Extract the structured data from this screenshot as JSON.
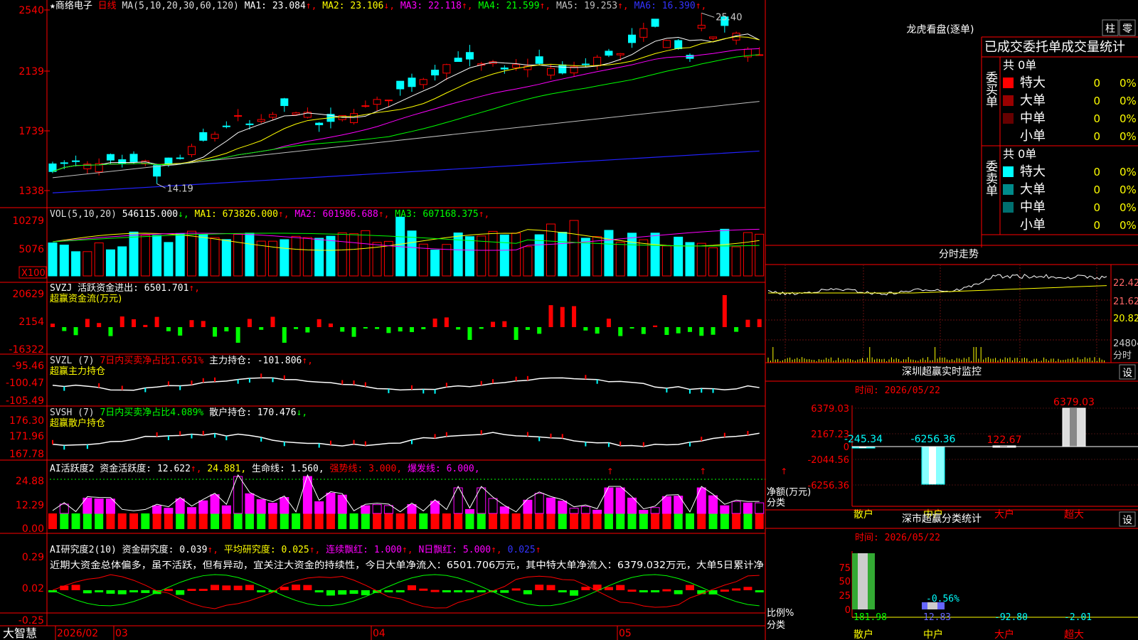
{
  "stock": {
    "name": "商络电子",
    "period": "日线",
    "star": "★"
  },
  "price": {
    "axis_labels": [
      "2540",
      "2139",
      "1739",
      "1338"
    ],
    "ma_header": "MA(5,10,20,30,60,120)",
    "ma_values": [
      {
        "label": "MA1: 23.084",
        "arrow": "↑",
        "color": "#ffffff"
      },
      {
        "label": "MA2: 23.106",
        "arrow": "↓",
        "color": "#ffff00"
      },
      {
        "label": "MA3: 22.118",
        "arrow": "↑",
        "color": "#ff00ff"
      },
      {
        "label": "MA4: 21.599",
        "arrow": "↑",
        "color": "#00ff00"
      },
      {
        "label": "MA5: 19.253",
        "arrow": "↑",
        "color": "#c0c0c0"
      },
      {
        "label": "MA6: 16.390",
        "arrow": "↑",
        "color": "#3333ff"
      }
    ],
    "high_label": "25.40",
    "low_label": "14.19"
  },
  "vol": {
    "header": "VOL(5,10,20)",
    "value": "546115.000",
    "value_arrow": "↓",
    "mas": [
      {
        "label": "MA1: 673826.000",
        "arrow": "↑",
        "color": "#ffff00"
      },
      {
        "label": "MA2: 601986.688",
        "arrow": "↑",
        "color": "#ff00ff"
      },
      {
        "label": "MA3: 607168.375",
        "arrow": "↑",
        "color": "#00ff00"
      }
    ],
    "axis_labels": [
      "10279",
      "5076"
    ],
    "unit": "X100"
  },
  "svzj": {
    "header": "SVZJ  活跃资金进出: 6501.701",
    "arrow": "↑",
    "subtitle": "超赢资金流(万元)",
    "axis_labels": [
      "20629",
      "2154",
      "-16322"
    ]
  },
  "svzl": {
    "header_pre": "SVZL (7)",
    "header_red": "7日内买卖净占比1.651%",
    "header_post": "主力持仓: -101.806",
    "arrow": "↑,",
    "subtitle": "超赢主力持仓",
    "axis_labels": [
      "-95.46",
      "-100.47",
      "-105.49"
    ]
  },
  "svsh": {
    "header_pre": "SVSH (7)",
    "header_green": "7日内买卖净占比4.089%",
    "header_post": "散户持仓: 170.476",
    "arrow": "↓,",
    "subtitle": "超赢散户持仓",
    "axis_labels": [
      "176.30",
      "171.96",
      "167.78"
    ]
  },
  "ai1": {
    "header": "AI活跃度2 资金活跃度: 12.622",
    "a1": "↑,",
    "yellow": "24.881,",
    "life": "生命线: 1.560,",
    "strong": "强势线: 3.000,",
    "burst": "爆发线: 6.000,",
    "axis_labels": [
      "24.88",
      "12.29",
      "0.00"
    ]
  },
  "ai2": {
    "header": "AI研究度2(10) 资金研究度: 0.039",
    "arrow": "↑,",
    "avg": "平均研究度: 0.025",
    "avg_arrow": "↑,",
    "cont": "连续飘红: 1.000",
    "cont_arrow": "↑,",
    "nday": "N日飘红: 5.000",
    "nday_arrow": "↑,",
    "last": "0.025",
    "last_arrow": "↑",
    "commentary": "近期大资金总体偏多，虽不活跃，但有异动，宜关注大资金的持续性，今日大单净流入：6501.706万元，其中特大单净流入：6379.032万元，大单5日累计净",
    "axis_labels": [
      "0.29",
      "0.02",
      "-0.25"
    ]
  },
  "time_axis": {
    "app": "大智慧",
    "labels": [
      "2026/02",
      "03",
      "04",
      "05"
    ]
  },
  "dragon": {
    "title": "龙虎看盘(逐单)",
    "btn1": "柱",
    "btn2": "零",
    "header": "已成交委托单成交量统计",
    "buy": {
      "label": "委买单",
      "total": "共 0单",
      "rows": [
        {
          "name": "特大",
          "value": "0",
          "pct": "0%",
          "color": "#ff0000"
        },
        {
          "name": "大单",
          "value": "0",
          "pct": "0%",
          "color": "#990000"
        },
        {
          "name": "中单",
          "value": "0",
          "pct": "0%",
          "color": "#660000"
        },
        {
          "name": "小单",
          "value": "0",
          "pct": "0%",
          "color": ""
        }
      ]
    },
    "sell": {
      "label": "委卖单",
      "total": "共 0单",
      "rows": [
        {
          "name": "特大",
          "value": "0",
          "pct": "0%",
          "color": "#00ffff"
        },
        {
          "name": "大单",
          "value": "0",
          "pct": "0%",
          "color": "#008b8b"
        },
        {
          "name": "中单",
          "value": "0",
          "pct": "0%",
          "color": "#007070"
        },
        {
          "name": "小单",
          "value": "0",
          "pct": "0%",
          "color": ""
        }
      ]
    }
  },
  "intraday": {
    "title": "分时走势",
    "axis": [
      "22.42",
      "21.62",
      "20.82",
      "24804"
    ],
    "unit": "分时"
  },
  "sz_monitor": {
    "title": "深圳超赢实时监控",
    "btn": "设",
    "date": "时间: 2026/05/22",
    "ylabels": [
      "6379.03",
      "2167.23",
      "0",
      "-2044.56",
      "-6256.36"
    ],
    "side1": "净额(万元)",
    "side2": "分类",
    "chart_data": {
      "type": "bar",
      "categories": [
        "散户",
        "中户",
        "大户",
        "超大"
      ],
      "values": [
        -245.34,
        -6256.36,
        122.67,
        6379.03
      ],
      "labels": [
        "-245.34",
        "-6256.36",
        "122.67",
        "6379.03"
      ],
      "ylim": [
        -6256.36,
        6379.03
      ]
    }
  },
  "sz_class": {
    "title": "深市超赢分类统计",
    "btn": "设",
    "date": "时间: 2026/05/22",
    "ylabels": [
      "75",
      "50",
      "25",
      "0"
    ],
    "side1": "比例%",
    "side2": "分类",
    "mid_label": "-0.56%",
    "chart_data": {
      "type": "bar",
      "categories": [
        "散户",
        "中户",
        "大户",
        "超大"
      ],
      "values": [
        181.98,
        12.83,
        -92.8,
        -2.01
      ],
      "labels": [
        "181.98",
        "12.83",
        "-92.80",
        "-2.01"
      ],
      "ylim": [
        0,
        75
      ]
    }
  }
}
